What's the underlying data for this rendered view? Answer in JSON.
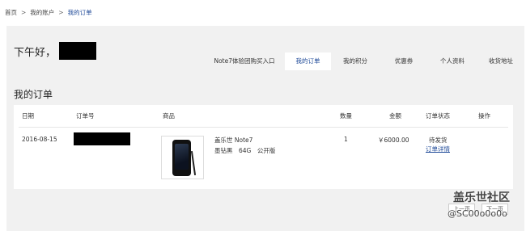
{
  "breadcrumb": {
    "items": [
      "首页",
      "我的账户",
      "我的订单"
    ],
    "separator": ">"
  },
  "header": {
    "greeting": "下午好，"
  },
  "tabs": [
    {
      "label": "Note7体验团购买入口",
      "active": false
    },
    {
      "label": "我的订单",
      "active": true
    },
    {
      "label": "我的积分",
      "active": false
    },
    {
      "label": "优惠券",
      "active": false
    },
    {
      "label": "个人资料",
      "active": false
    },
    {
      "label": "收货地址",
      "active": false
    }
  ],
  "orders": {
    "title": "我的订单",
    "columns": [
      "日期",
      "订单号",
      "商品",
      "数量",
      "金额",
      "订单状态",
      "操作"
    ],
    "rows": [
      {
        "date": "2016-08-15",
        "product_name": "盖乐世 Note7",
        "product_spec": "墨钻黑　64G　公开版",
        "quantity": "1",
        "amount": "￥6000.00",
        "status": "待发货",
        "detail_link": "订单详情"
      }
    ]
  },
  "pager": {
    "prev": "上一页",
    "next": "下一页"
  },
  "watermark": {
    "title": "盖乐世社区",
    "handle": "@SC00o0o0o"
  },
  "colors": {
    "accent": "#1f4a98",
    "panel_bg": "#f1f1f1"
  }
}
